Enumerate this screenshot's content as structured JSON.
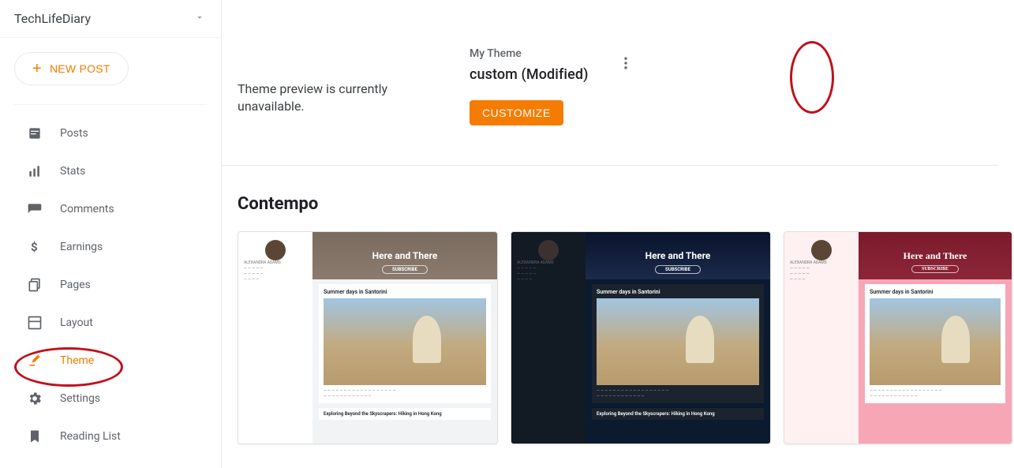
{
  "blog": {
    "name": "TechLifeDiary"
  },
  "buttons": {
    "new_post": "NEW POST",
    "customize": "CUSTOMIZE"
  },
  "nav": {
    "posts": "Posts",
    "stats": "Stats",
    "comments": "Comments",
    "earnings": "Earnings",
    "pages": "Pages",
    "layout": "Layout",
    "theme": "Theme",
    "settings": "Settings",
    "reading_list": "Reading List"
  },
  "theme_panel": {
    "preview_missing": "Theme preview is currently unavailable.",
    "my_theme_label": "My Theme",
    "current_theme": "custom (Modified)"
  },
  "section": {
    "title": "Contempo"
  },
  "cards": {
    "hero_title": "Here and There",
    "post_title": "Summer days in Santorini",
    "footer_post": "Exploring Beyond the Skyscrapers: Hiking in Hong Kong"
  }
}
